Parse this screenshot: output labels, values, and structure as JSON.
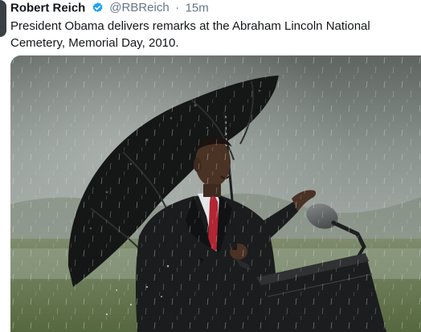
{
  "tweet": {
    "author_name": "Robert Reich",
    "verified": true,
    "handle": "@RBReich",
    "separator": "·",
    "time": "15m",
    "text": "President Obama delivers remarks at the Abraham Lincoln National Cemetery, Memorial Day, 2010."
  },
  "icons": {
    "verified": "verified-badge-icon",
    "avatar": "avatar"
  },
  "colors": {
    "brand_blue": "#1da1f2",
    "text": "#14171a",
    "secondary": "#657786"
  },
  "media": {
    "type": "photo",
    "subject": "speaker-with-umbrella-in-rain"
  }
}
